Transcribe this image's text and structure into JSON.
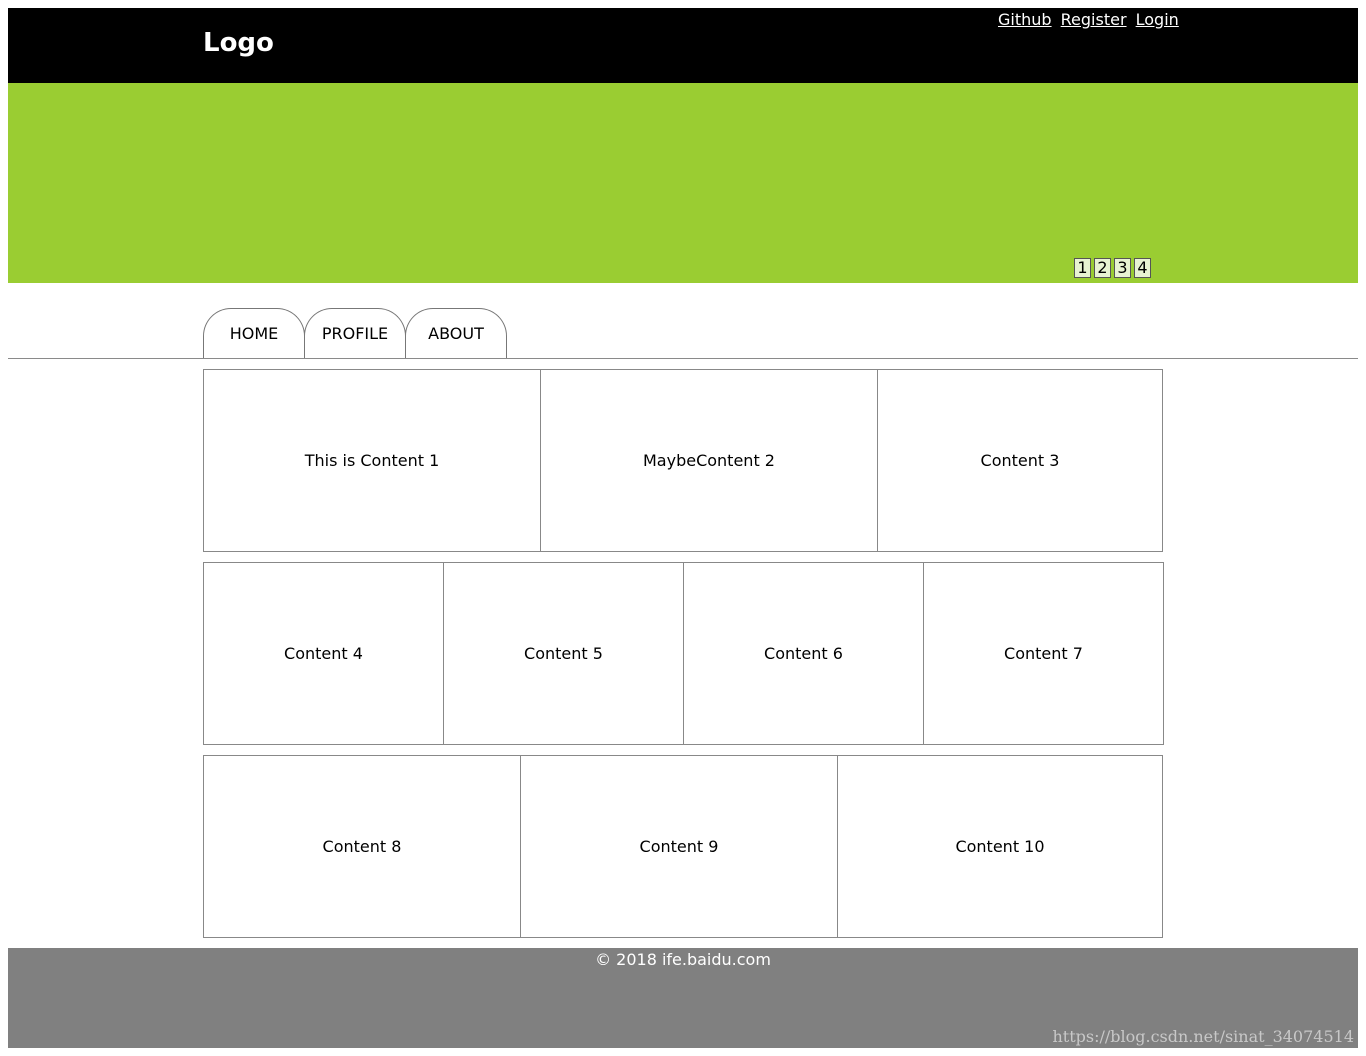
{
  "header": {
    "logo": "Logo",
    "links": [
      "Github",
      "Register",
      "Login"
    ]
  },
  "banner": {
    "background": "#9acd32",
    "slides": [
      "1",
      "2",
      "3",
      "4"
    ]
  },
  "tabs": [
    "HOME",
    "PROFILE",
    "ABOUT"
  ],
  "content": {
    "row1": [
      "This is Content 1",
      "MaybeContent 2",
      "Content 3"
    ],
    "row2": [
      "Content 4",
      "Content 5",
      "Content 6",
      "Content 7"
    ],
    "row3": [
      "Content 8",
      "Content 9",
      "Content 10"
    ]
  },
  "footer": {
    "copyright": "© 2018 ife.baidu.com",
    "watermark": "https://blog.csdn.net/sinat_34074514"
  }
}
